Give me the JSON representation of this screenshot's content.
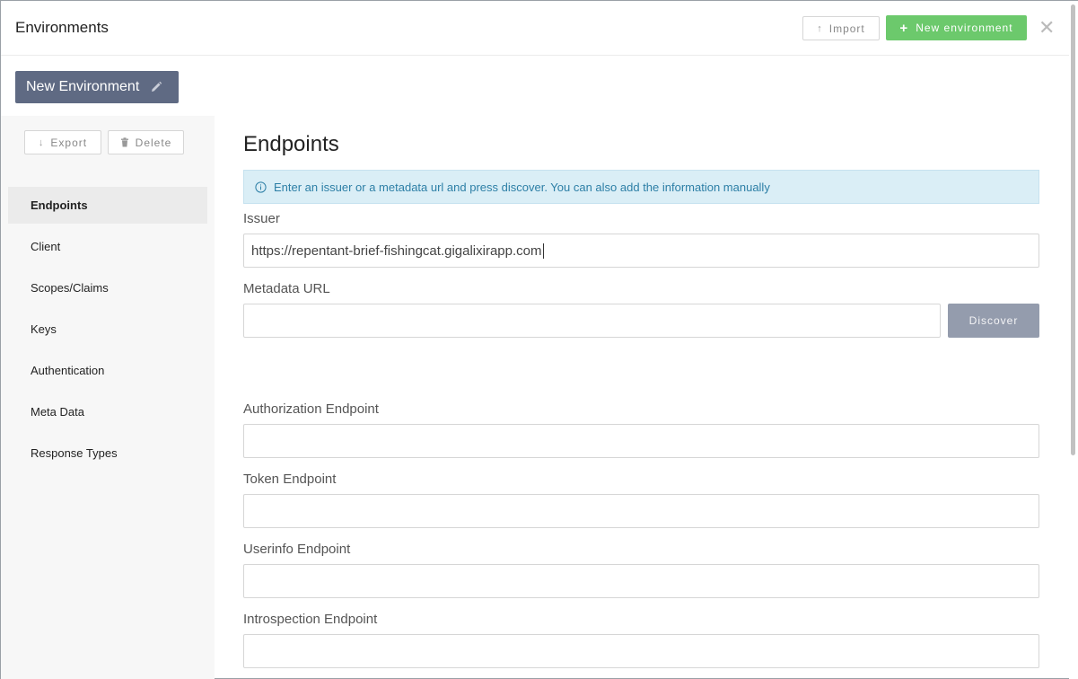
{
  "header": {
    "title": "Environments",
    "import_label": "Import",
    "new_env_label": "New environment",
    "close_glyph": "✕"
  },
  "env_tab": {
    "name": "New Environment"
  },
  "sidebar": {
    "export_label": "Export",
    "delete_label": "Delete",
    "items": [
      {
        "label": "Endpoints",
        "active": true
      },
      {
        "label": "Client"
      },
      {
        "label": "Scopes/Claims"
      },
      {
        "label": "Keys"
      },
      {
        "label": "Authentication"
      },
      {
        "label": "Meta Data"
      },
      {
        "label": "Response Types"
      }
    ]
  },
  "main": {
    "title": "Endpoints",
    "info": "Enter an issuer or a metadata url and press discover. You can also add the information manually",
    "issuer": {
      "label": "Issuer",
      "value": "https://repentant-brief-fishingcat.gigalixirapp.com"
    },
    "metadata_url": {
      "label": "Metadata URL",
      "value": ""
    },
    "discover_label": "Discover",
    "authorization": {
      "label": "Authorization Endpoint",
      "value": ""
    },
    "token": {
      "label": "Token Endpoint",
      "value": ""
    },
    "userinfo": {
      "label": "Userinfo Endpoint",
      "value": ""
    },
    "introspection": {
      "label": "Introspection Endpoint",
      "value": ""
    }
  },
  "colors": {
    "primary_green": "#6cc96c",
    "env_tab_bg": "#5f6a83",
    "info_bg": "#daeef6",
    "info_text": "#2d7fa6",
    "discover_bg": "#949cad"
  },
  "icons": {
    "import": "arrow-up-icon",
    "new_env": "plus-icon",
    "close": "close-icon",
    "edit": "pencil-icon",
    "export": "arrow-down-icon",
    "delete": "trash-icon",
    "info": "info-icon"
  }
}
